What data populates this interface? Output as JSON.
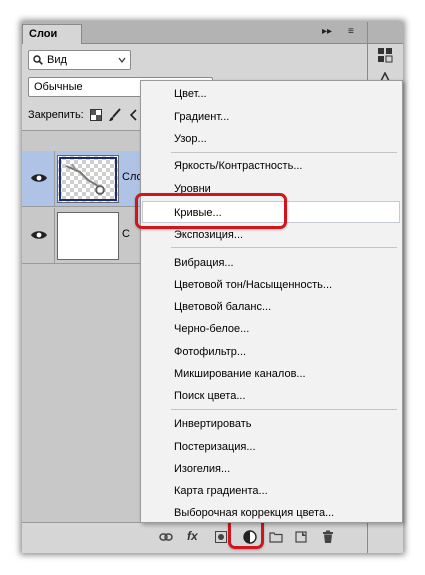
{
  "panel": {
    "tab_label": "Слои",
    "collapse_label": "▸▸",
    "menu_label": "≡",
    "search_placeholder": "Вид",
    "blend_mode": "Обычные",
    "lock_label": "Закрепить:"
  },
  "layers": [
    {
      "name": "Сло",
      "selected": true
    },
    {
      "name": "С",
      "selected": false
    }
  ],
  "bottom_bar": {
    "fx_label": "fx"
  },
  "menu": {
    "items": [
      "Цвет...",
      "Градиент...",
      "Узор...",
      "Яркость/Контрастность...",
      "Уровни",
      "Кривые...",
      "Экспозиция...",
      "Вибрация...",
      "Цветовой тон/Насыщенность...",
      "Цветовой баланс...",
      "Черно-белое...",
      "Фотофильтр...",
      "Микширование каналов...",
      "Поиск цвета...",
      "Инвертировать",
      "Постеризация...",
      "Изогелия...",
      "Карта градиента...",
      "Выборочная коррекция цвета..."
    ],
    "highlighted": "Кривые..."
  },
  "colors": {
    "highlight_red": "#d0161b",
    "selected_layer": "#aec3e6",
    "panel_bg": "#d6d6d6"
  }
}
